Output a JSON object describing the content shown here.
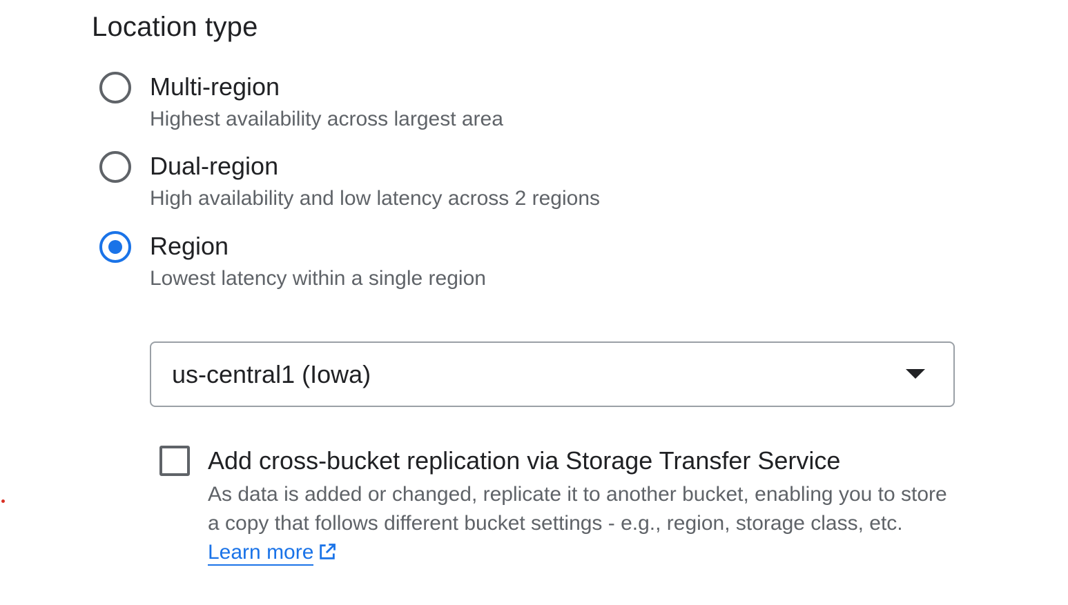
{
  "location_type": {
    "title": "Location type",
    "options": [
      {
        "label": "Multi-region",
        "description": "Highest availability across largest area",
        "selected": false
      },
      {
        "label": "Dual-region",
        "description": "High availability and low latency across 2 regions",
        "selected": false
      },
      {
        "label": "Region",
        "description": "Lowest latency within a single region",
        "selected": true
      }
    ],
    "region_select": {
      "value": "us-central1 (Iowa)"
    },
    "replication": {
      "checked": false,
      "label": "Add cross-bucket replication via Storage Transfer Service",
      "description": "As data is added or changed, replicate it to another bucket, enabling you to store a copy that follows different bucket settings - e.g., region, storage class, etc.",
      "link_text": "Learn more",
      "link_icon": "external-link-icon"
    }
  },
  "colors": {
    "accent": "#1a73e8",
    "text_primary": "#202124",
    "text_secondary": "#5f6368",
    "border": "#9aa0a6",
    "marker": "#d93025"
  }
}
